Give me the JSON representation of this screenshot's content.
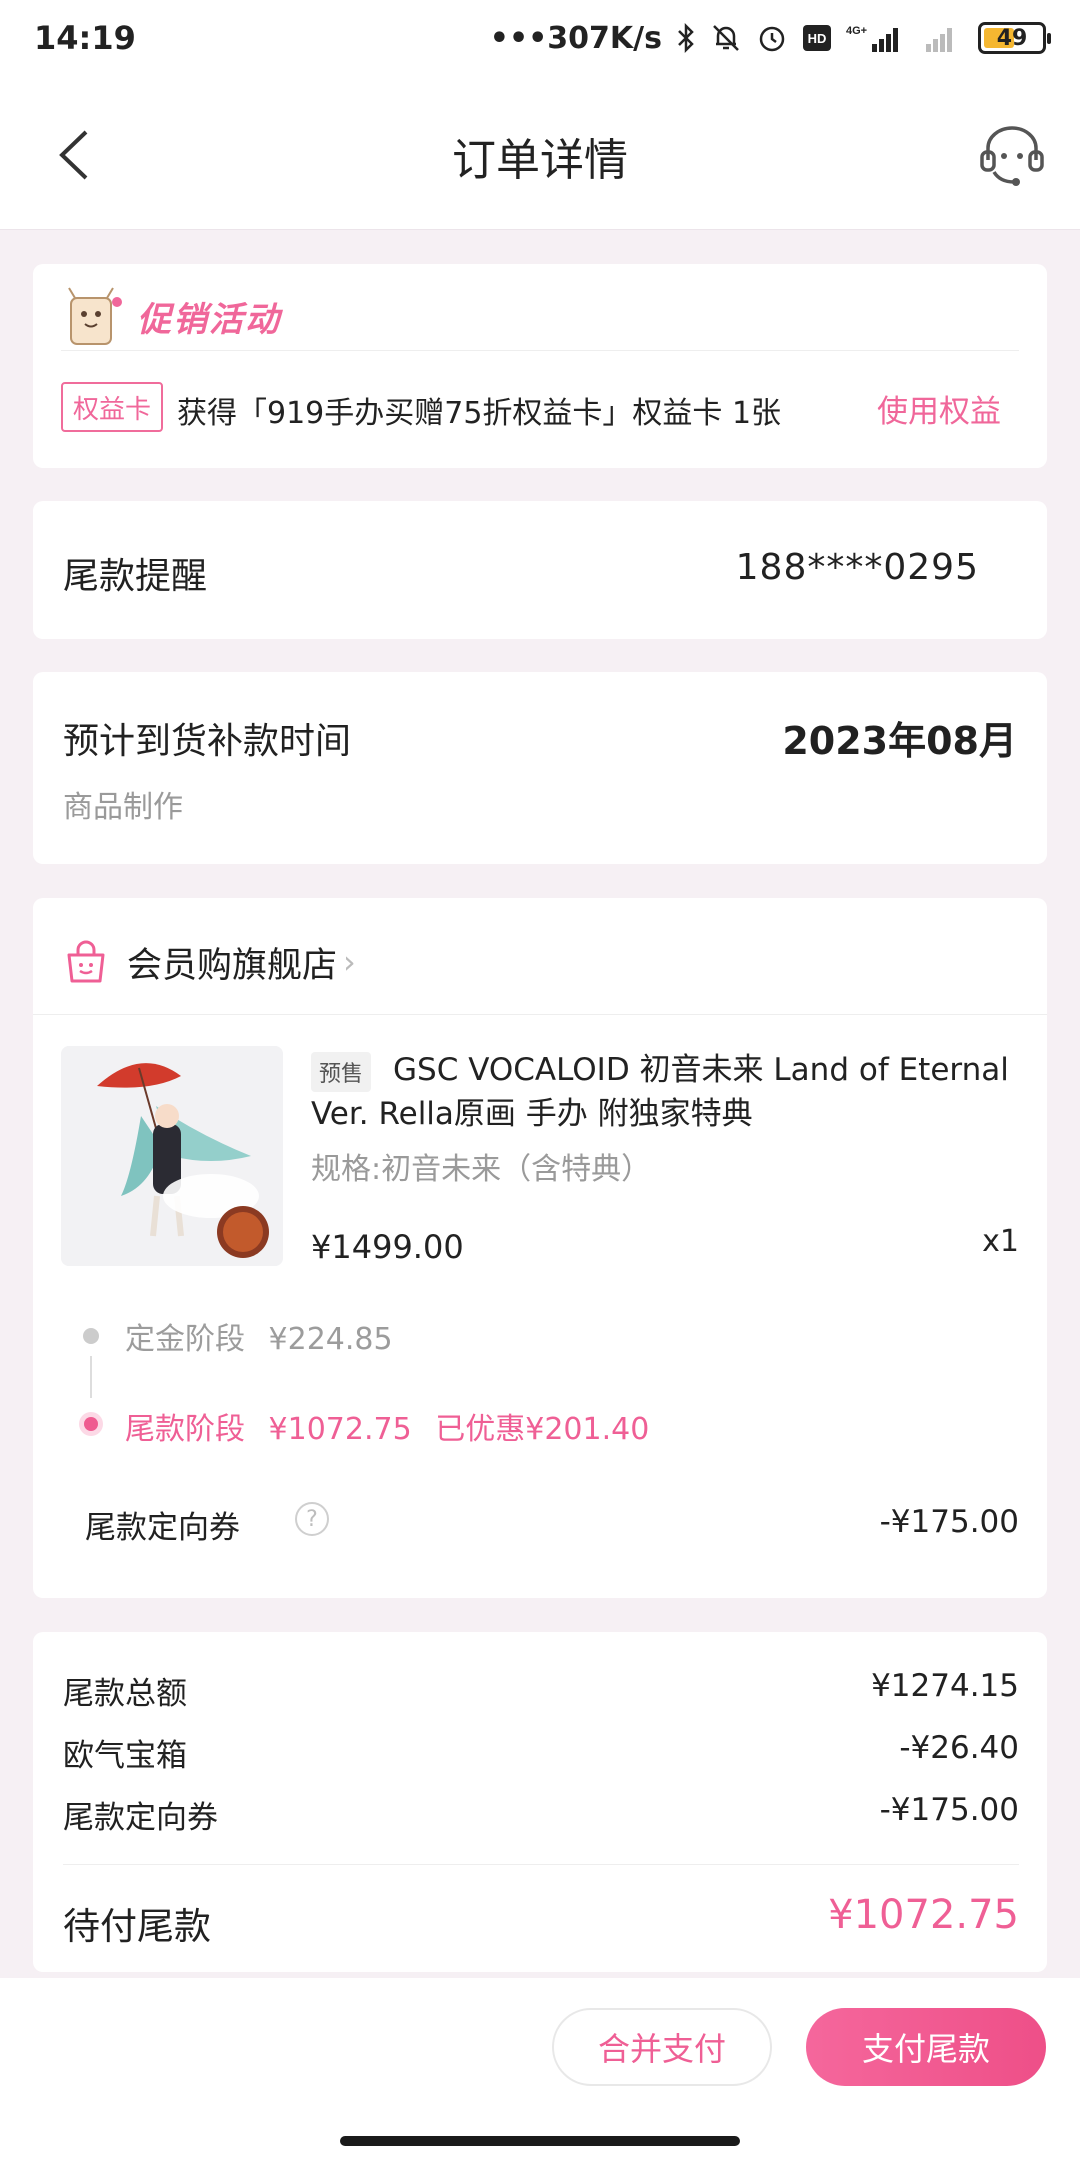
{
  "status_bar": {
    "time": "14:19",
    "network_speed": "•••307K/s",
    "battery_level": "49",
    "network_type": "4G+"
  },
  "nav": {
    "title": "订单详情"
  },
  "promo": {
    "title": "促销活动",
    "tag": "权益卡",
    "text": "获得「919手办买赠75折权益卡」权益卡 1张",
    "action": "使用权益"
  },
  "reminder": {
    "label": "尾款提醒",
    "phone": "188****0295"
  },
  "eta": {
    "label": "预计到货补款时间",
    "value": "2023年08月",
    "sub": "商品制作"
  },
  "store": {
    "name": "会员购旗舰店"
  },
  "product": {
    "presale_tag": "预售",
    "title": "GSC VOCALOID 初音未来 Land of Eternal Ver. Rella原画 手办 附独家特典",
    "spec": "规格:初音未来（含特典）",
    "price": "¥1499.00",
    "quantity": "x1"
  },
  "stages": {
    "deposit_label": "定金阶段",
    "deposit_amount": "¥224.85",
    "final_label": "尾款阶段",
    "final_amount": "¥1072.75",
    "final_discount": "已优惠¥201.40"
  },
  "coupon": {
    "label": "尾款定向券",
    "help": "?",
    "value": "-¥175.00"
  },
  "summary": {
    "rows": [
      {
        "label": "尾款总额",
        "value": "¥1274.15"
      },
      {
        "label": "欧气宝箱",
        "value": "-¥26.40"
      },
      {
        "label": "尾款定向券",
        "value": "-¥175.00"
      }
    ],
    "total_label": "待付尾款",
    "total_value": "¥1072.75"
  },
  "actions": {
    "merge_pay": "合并支付",
    "pay_final": "支付尾款"
  },
  "colors": {
    "accent": "#ef5f95",
    "background": "#f6f0f4"
  }
}
